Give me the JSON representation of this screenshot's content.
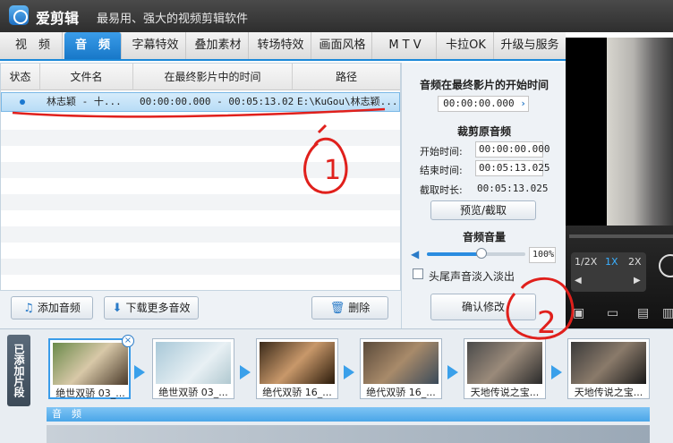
{
  "app": {
    "title": "爱剪辑",
    "slogan": "最易用、强大的视频剪辑软件"
  },
  "tabs": [
    "视　频",
    "音　频",
    "字幕特效",
    "叠加素材",
    "转场特效",
    "画面风格",
    "M T V",
    "卡拉OK",
    "升级与服务"
  ],
  "audio_list": {
    "columns": [
      "状态",
      "文件名",
      "在最终影片中的时间",
      "路径"
    ],
    "rows": [
      {
        "file": "林志颖 - 十...",
        "time": "00:00:00.000 - 00:05:13.025",
        "path": "E:\\KuGou\\林志颖..."
      }
    ]
  },
  "buttons": {
    "add_audio": "添加音频",
    "download": "下载更多音效",
    "delete": "删除"
  },
  "side": {
    "start_title": "音频在最终影片的开始时间",
    "start_value": "00:00:00.000",
    "trim_title": "裁剪原音频",
    "start_label": "开始时间:",
    "start_time": "00:00:00.000",
    "end_label": "结束时间:",
    "end_time": "00:05:13.025",
    "dur_label": "截取时长:",
    "dur_value": "00:05:13.025",
    "preview_btn": "预览/截取",
    "volume_title": "音频音量",
    "volume_value": "100%",
    "volume_level": 1.0,
    "fade_label": "头尾声音淡入淡出",
    "confirm": "确认修改"
  },
  "player": {
    "speed_half": "1/2X",
    "speed_1": "1X",
    "speed_2": "2X"
  },
  "timeline": {
    "label": "已添加片段",
    "clips": [
      "绝世双骄 03_...",
      "绝世双骄 03_...",
      "绝代双骄 16_...",
      "绝代双骄 16_...",
      "天地传说之宝...",
      "天地传说之宝..."
    ],
    "audio_label": "音　频"
  },
  "annotations": {
    "mark1": "1",
    "mark2": "2"
  },
  "colors": {
    "accent": "#1a88d8",
    "annotation": "#e0201c"
  }
}
